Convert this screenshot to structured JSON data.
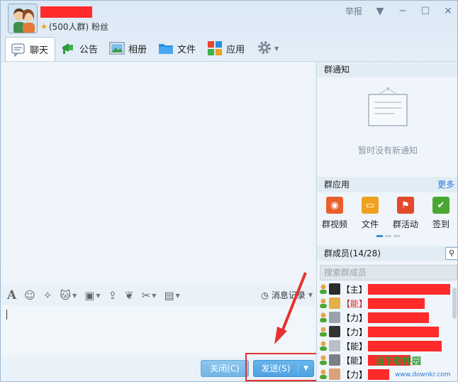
{
  "header": {
    "group_meta": "(500人群) 粉丝",
    "controls": {
      "report": "举报"
    }
  },
  "tabs": [
    {
      "label": "聊天",
      "icon": "chat-icon",
      "active": true
    },
    {
      "label": "公告",
      "icon": "announcement-icon"
    },
    {
      "label": "相册",
      "icon": "album-icon"
    },
    {
      "label": "文件",
      "icon": "folder-icon"
    },
    {
      "label": "应用",
      "icon": "apps-icon"
    }
  ],
  "input_toolbar": {
    "history_label": "消息记录"
  },
  "actions": {
    "close_label": "关闭(C)",
    "send_label": "发送(S)"
  },
  "notice": {
    "title": "群通知",
    "empty": "暂时没有新通知"
  },
  "apps": {
    "title": "群应用",
    "more": "更多",
    "items": [
      {
        "label": "群视频",
        "color": "#e8602c"
      },
      {
        "label": "文件",
        "color": "#f0a21e"
      },
      {
        "label": "群活动",
        "color": "#e24a2b"
      },
      {
        "label": "签到",
        "color": "#4aa832"
      }
    ]
  },
  "members": {
    "title": "群成员(14/28)",
    "search_placeholder": "搜索群成员",
    "list": [
      {
        "role": "【主】"
      },
      {
        "role": "【能】",
        "red": true
      },
      {
        "role": "【力】"
      },
      {
        "role": "【力】"
      },
      {
        "role": "【能】"
      },
      {
        "role": "【能】"
      },
      {
        "role": "【力】"
      }
    ]
  },
  "watermark": {
    "text": "当下软件园",
    "url": "www.downkr.com"
  },
  "colors": {
    "redaction": "#ff2a2a",
    "highlight": "#e6322e",
    "accent": "#3d93d4"
  }
}
